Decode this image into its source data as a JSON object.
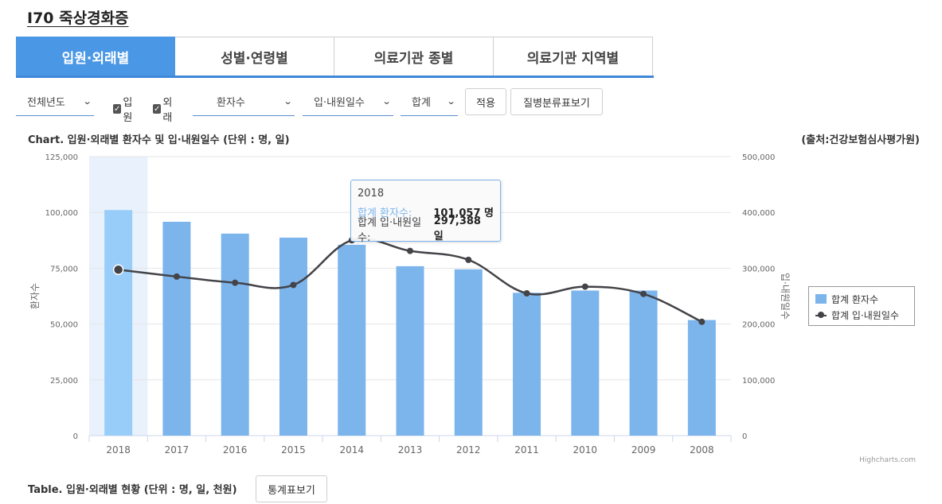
{
  "page": {
    "title": "I70 죽상경화증"
  },
  "tabs": [
    {
      "label": "입원·외래별",
      "active": true
    },
    {
      "label": "성별·연령별",
      "active": false
    },
    {
      "label": "의료기관 종별",
      "active": false
    },
    {
      "label": "의료기관 지역별",
      "active": false
    }
  ],
  "filters": {
    "year": "전체년도",
    "inpatient": "입원",
    "outpatient": "외래",
    "metric1": "환자수",
    "metric2": "입·내원일수",
    "total": "합계",
    "apply_label": "적용",
    "classification_label": "질병분류표보기"
  },
  "chart_header": {
    "title": "Chart. 입원·외래별 환자수 및 입·내원일수 (단위 : 명, 일)",
    "source": "(출처:건강보험심사평가원)"
  },
  "chart_data": {
    "type": "bar",
    "categories": [
      "2018",
      "2017",
      "2016",
      "2015",
      "2014",
      "2013",
      "2012",
      "2011",
      "2010",
      "2009",
      "2008"
    ],
    "series": [
      {
        "name": "합계 환자수",
        "type": "bar",
        "axis": "left",
        "color": "#7cb5ec",
        "values": [
          101057,
          95800,
          90500,
          88700,
          85500,
          75900,
          74500,
          64000,
          65000,
          65000,
          51800
        ]
      },
      {
        "name": "합계 입·내원일수",
        "type": "line",
        "axis": "right",
        "color": "#434348",
        "values": [
          297388,
          285000,
          274000,
          270000,
          350000,
          331000,
          315000,
          255000,
          267000,
          254000,
          204000
        ]
      }
    ],
    "left_axis": {
      "label": "환자수",
      "ylim": [
        0,
        125000
      ],
      "ticks": [
        "0",
        "25,000",
        "50,000",
        "75,000",
        "100,000",
        "125,000"
      ]
    },
    "right_axis": {
      "label": "입·내원일수",
      "ylim": [
        0,
        500000
      ],
      "ticks": [
        "0",
        "100,000",
        "200,000",
        "300,000",
        "400,000",
        "500,000"
      ]
    },
    "grid": true,
    "legend_position": "right",
    "highlight_category": "2018"
  },
  "tooltip": {
    "year": "2018",
    "row1_name": "합계 환자수:",
    "row1_value": "101,057 명",
    "row2_name": "합계 입·내원일수:",
    "row2_value": "297,388 일"
  },
  "legend": {
    "item1": "합계 환자수",
    "item2": "합계 입·내원일수"
  },
  "credits": "Highcharts.com",
  "table_header": {
    "title": "Table. 입원·외래별 현황 (단위 : 명, 일, 천원)",
    "stats_button": "통계표보기"
  }
}
